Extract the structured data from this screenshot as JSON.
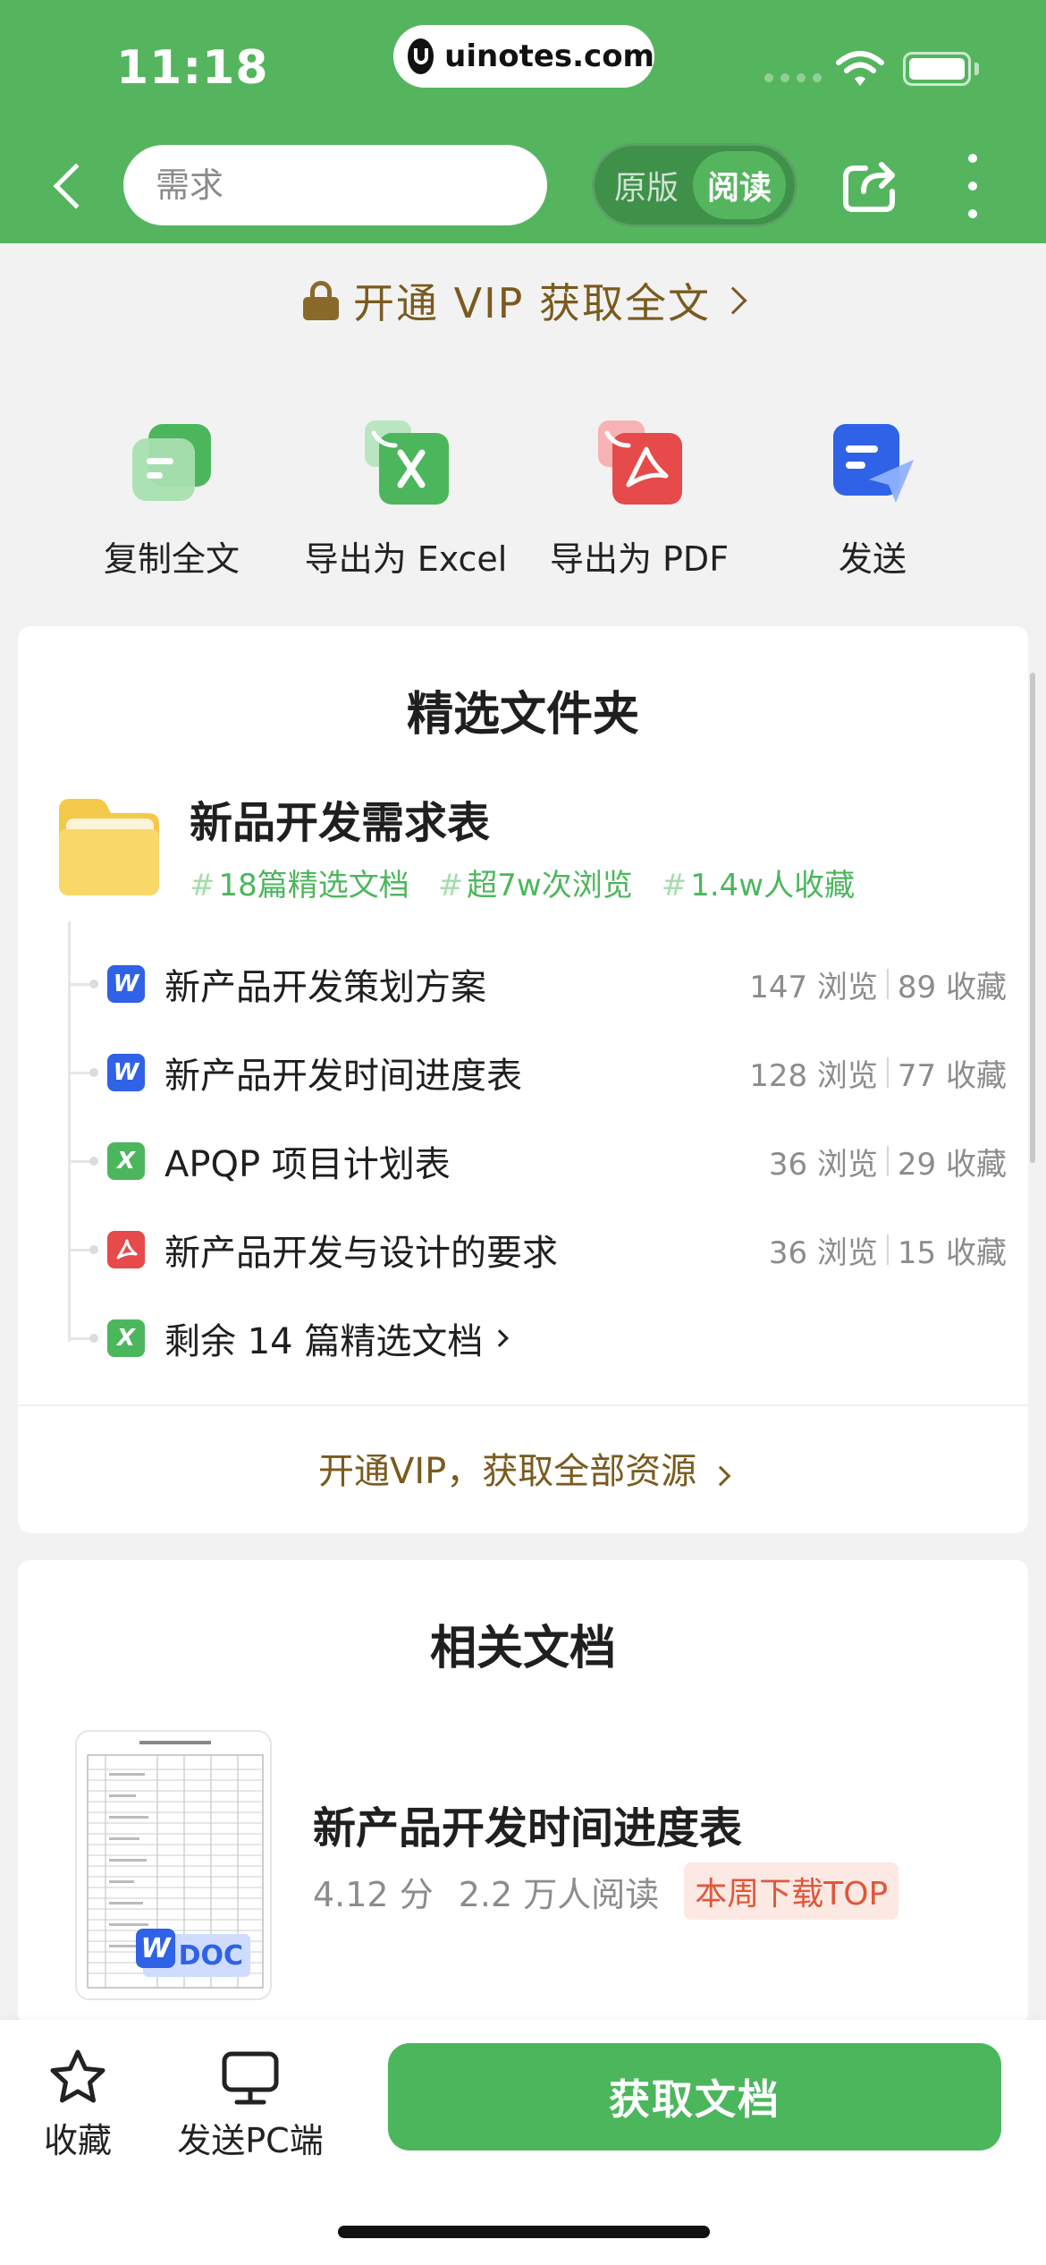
{
  "status_bar": {
    "time": "11:18",
    "url": "uinotes.com"
  },
  "header": {
    "search_placeholder": "需求",
    "mode_original": "原版",
    "mode_reading": "阅读"
  },
  "vip_banner": {
    "text": "开通 VIP 获取全文"
  },
  "actions": [
    {
      "label": "复制全文",
      "icon": "copy-doc-icon"
    },
    {
      "label": "导出为 Excel",
      "icon": "excel-export-icon"
    },
    {
      "label": "导出为 PDF",
      "icon": "pdf-export-icon"
    },
    {
      "label": "发送",
      "icon": "send-icon"
    }
  ],
  "featured_folder": {
    "section_title": "精选文件夹",
    "name": "新品开发需求表",
    "tags": [
      "18篇精选文档",
      "超7w次浏览",
      "1.4w人收藏"
    ],
    "items": [
      {
        "type": "word",
        "badge": "W",
        "title": "新产品开发策划方案",
        "views": "147 浏览",
        "favorites": "89 收藏"
      },
      {
        "type": "word",
        "badge": "W",
        "title": "新产品开发时间进度表",
        "views": "128 浏览",
        "favorites": "77 收藏"
      },
      {
        "type": "excel",
        "badge": "X",
        "title": "APQP 项目计划表",
        "views": "36 浏览",
        "favorites": "29 收藏"
      },
      {
        "type": "pdf",
        "badge": "",
        "title": "新产品开发与设计的要求",
        "views": "36 浏览",
        "favorites": "15 收藏"
      }
    ],
    "more": {
      "badge": "X",
      "text": "剩余 14 篇精选文档"
    },
    "vip_link": "开通VIP，获取全部资源"
  },
  "related": {
    "section_title": "相关文档",
    "doc": {
      "title": "新产品开发时间进度表",
      "score": "4.12 分",
      "reads": "2.2 万人阅读",
      "rank_badge": "本周下载TOP",
      "thumb_badge": "DOC"
    }
  },
  "bottom_bar": {
    "favorite_label": "收藏",
    "send_pc_label": "发送PC端",
    "cta_label": "获取文档"
  },
  "colors": {
    "brand_green": "#55b55f",
    "cta_green": "#4cb65d",
    "vip_gold": "#7a5a1e",
    "word_blue": "#2f62e6",
    "pdf_red": "#e64a4a"
  }
}
